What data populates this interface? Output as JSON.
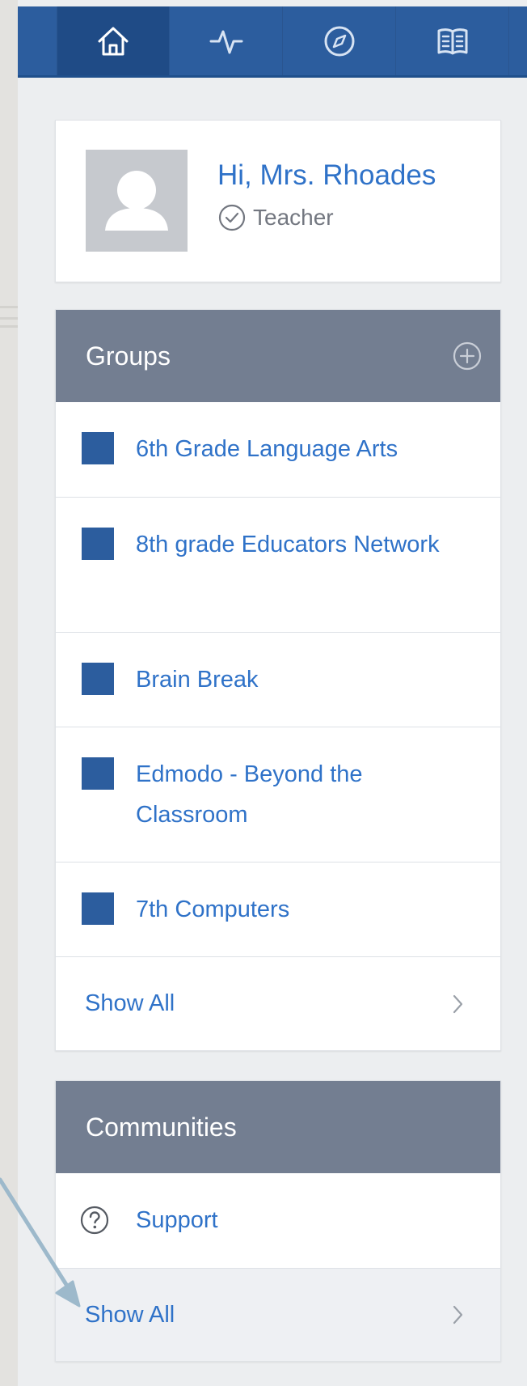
{
  "topbar": {
    "items": [
      {
        "icon": "home-icon",
        "active": true
      },
      {
        "icon": "activity-icon",
        "active": false
      },
      {
        "icon": "compass-icon",
        "active": false
      },
      {
        "icon": "book-icon",
        "active": false
      }
    ]
  },
  "profile": {
    "greeting": "Hi, Mrs. Rhoades",
    "role": "Teacher"
  },
  "groups": {
    "title": "Groups",
    "items": [
      {
        "label": "6th Grade Language Arts"
      },
      {
        "label": "8th grade Educators Network"
      },
      {
        "label": "Brain Break"
      },
      {
        "label": "Edmodo - Beyond the Classroom"
      },
      {
        "label": "7th Computers"
      }
    ],
    "show_all": "Show All"
  },
  "communities": {
    "title": "Communities",
    "items": [
      {
        "label": "Support",
        "icon": "help-circle-icon"
      }
    ],
    "show_all": "Show All"
  },
  "colors": {
    "topbar": "#2c5d9e",
    "accent_text": "#2f72c8",
    "panel_header": "#737e91",
    "group_swatch": "#2c5d9e",
    "annotation_arrow": "#9db9cb"
  }
}
